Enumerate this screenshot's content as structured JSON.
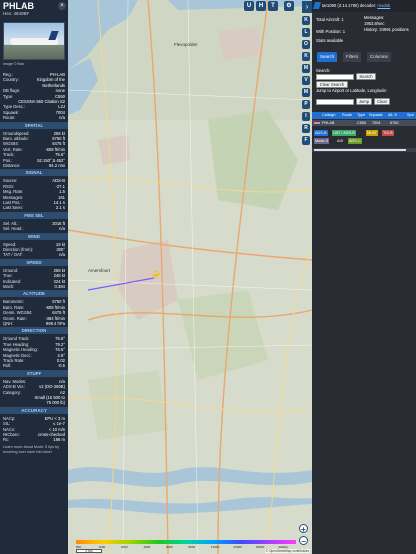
{
  "detail": {
    "callsign": "PHLAB",
    "hex": "Hex: 4840BF",
    "close_icon": "close-icon",
    "photo_credit": "Image © flickr",
    "fields": [
      {
        "k": "Reg.:",
        "v": "PH-LAB"
      },
      {
        "k": "Country:",
        "v": "Kingdom of the"
      },
      {
        "k": "",
        "v": "Netherlands"
      },
      {
        "k": "DB flags:",
        "v": "none"
      },
      {
        "k": "Type:",
        "v": "C550"
      },
      {
        "k": "",
        "v": "CESSNA 550 Citation S2"
      },
      {
        "k": "Type Desc.:",
        "v": "L2J"
      },
      {
        "k": "Squawk:",
        "v": "7004"
      },
      {
        "k": "Route:",
        "v": "n/a"
      }
    ],
    "sections": {
      "spatial": "SPATIAL",
      "signal": "SIGNAL",
      "fms": "FMS SEL",
      "wind": "WIND",
      "speed": "SPEED",
      "altitude": "ALTITUDE",
      "direction": "DIRECTION",
      "stuff": "STUFF",
      "accuracy": "ACCURACY"
    },
    "spatial": [
      {
        "k": "Groundspeed:",
        "v": "258 kt"
      },
      {
        "k": "Baro. altitude:",
        "v": "6750 ft"
      },
      {
        "k": "WGS84:",
        "v": "6475 ft"
      },
      {
        "k": "Vert. Rate:",
        "v": "-608 ft/min"
      },
      {
        "k": "Track:",
        "v": "75.6°"
      },
      {
        "k": "Pos.:",
        "v": "52.150°,5.452°"
      },
      {
        "k": "Distance:",
        "v": "84.2 nmi"
      }
    ],
    "signal": [
      {
        "k": "Source:",
        "v": "ADS-B"
      },
      {
        "k": "RSSI:",
        "v": "-27.1"
      },
      {
        "k": "Msg. Rate:",
        "v": "1.5"
      },
      {
        "k": "Messages:",
        "v": "161"
      },
      {
        "k": "Last Pos.:",
        "v": "14.1 s"
      },
      {
        "k": "Last Seen:",
        "v": "2.1 s"
      }
    ],
    "fms": [
      {
        "k": "Sel. Alt.:",
        "v": "2016 ft"
      },
      {
        "k": "Sel. Head.:",
        "v": "n/a"
      }
    ],
    "wind": [
      {
        "k": "Speed:",
        "v": "19 kt"
      },
      {
        "k": "Direction (from):",
        "v": "300°"
      },
      {
        "k": "TAT / OAT:",
        "v": "n/a"
      }
    ],
    "speed": [
      {
        "k": "Ground:",
        "v": "258 kt"
      },
      {
        "k": "True:",
        "v": "248 kt"
      },
      {
        "k": "Indicated:",
        "v": "224 kt"
      },
      {
        "k": "Mach:",
        "v": "0.384"
      }
    ],
    "altitude": [
      {
        "k": "Barometric:",
        "v": "6750 ft"
      },
      {
        "k": "Baro. Rate:",
        "v": "-608 ft/min"
      },
      {
        "k": "Geom. WGS84:",
        "v": "6475 ft"
      },
      {
        "k": "Geom. Rate:",
        "v": "-384 ft/min"
      },
      {
        "k": "QNH:",
        "v": "998.4 hPa"
      }
    ],
    "direction": [
      {
        "k": "Ground Track:",
        "v": "75.6°"
      },
      {
        "k": "True Heading:",
        "v": "79.2°"
      },
      {
        "k": "Magnetic Heading:",
        "v": "76.5°"
      },
      {
        "k": "Magnetic Decl.:",
        "v": "2.8°"
      },
      {
        "k": "Track Rate:",
        "v": "0.02"
      },
      {
        "k": "Roll:",
        "v": "-0.5"
      }
    ],
    "stuff": [
      {
        "k": "Nav. Modes:",
        "v": "n/a"
      },
      {
        "k": "ADS-B Ver.:",
        "v": "v2 (DO-260B)"
      },
      {
        "k": "Category:",
        "v": "A2"
      },
      {
        "k": "",
        "v": "Small (15 500 to"
      },
      {
        "k": "",
        "v": "75 000 lb)"
      }
    ],
    "accuracy": [
      {
        "k": "NACp:",
        "v": "EPU < 3 m"
      },
      {
        "k": "SIL:",
        "v": "≤ 1e-7"
      },
      {
        "k": "NACv:",
        "v": "< 10 m/s"
      },
      {
        "k": "NICbaro:",
        "v": "cross-checked"
      },
      {
        "k": "Rc:",
        "v": "186 m"
      }
    ],
    "footer": "Learn more about Mode S tips by hovering over each info label"
  },
  "map": {
    "top_buttons": [
      "U",
      "H",
      "T"
    ],
    "side_buttons": [
      "K",
      "L",
      "O",
      "K",
      "M",
      "V",
      "M",
      "P",
      "I",
      "R",
      "F"
    ],
    "place_labels": [
      "Flevopolder",
      "Amersfoort"
    ],
    "plane_icon": "aircraft-icon",
    "zoom_in": "+",
    "zoom_out": "−",
    "legend_ticks": [
      "500",
      "1000",
      "2000",
      "4000",
      "6000",
      "8000",
      "10000",
      "20000",
      "30000",
      "40000+"
    ],
    "scale": "2 NM",
    "attribution": "© OpenStreetMap contributors"
  },
  "panel": {
    "collapse_icon": "chevron-right-icon",
    "version_text": "tar1090 (3.14.1780) decoder: ",
    "decoder_link": "readsb",
    "stats": {
      "total_label": "Total Aircraft: 1",
      "with_pos": "With Position: 1",
      "stats_avail": "Stats available",
      "messages": "Messages:",
      "messages_val": "1953.8/sec",
      "history": "History: 24991 positions"
    },
    "tabs": [
      "Search",
      "Filters",
      "Columns"
    ],
    "search_label": "Search:",
    "search_button": "Search",
    "clear_search": "Clear Search",
    "jump_label": "Jump to Airport or Latitude, Longitude:",
    "jump_button": "Jump",
    "clear_button": "Clear"
  },
  "table": {
    "headers": [
      "",
      "Callsign",
      "Route",
      "Type",
      "Squawk",
      "Alt. ft",
      "Spd"
    ],
    "rows": [
      [
        "",
        "PHLAB",
        "",
        "C550",
        "7004",
        "6750",
        ""
      ]
    ],
    "row_color": "#454b57",
    "legend": [
      {
        "label": "ADS-B",
        "color": "#1f6fd0"
      },
      {
        "label": "UAT / ADS-R",
        "color": "#3aa86b"
      },
      {
        "label": "MLAT",
        "color": "#c8a000"
      },
      {
        "label": "TIS-B",
        "color": "#c04a4a"
      },
      {
        "label": "Mode-S",
        "color": "#6a6a8a"
      },
      {
        "label": "AIS",
        "color": "#2a2c33"
      },
      {
        "label": "ADS-C",
        "color": "#6a9a2a"
      }
    ]
  }
}
